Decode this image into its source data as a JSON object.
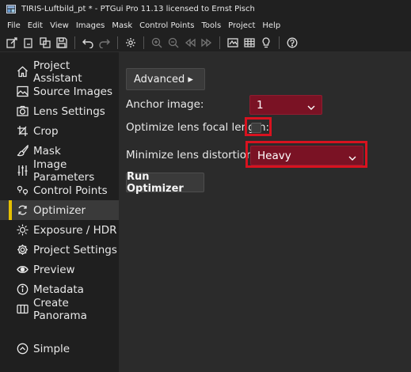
{
  "window": {
    "title": "TIRIS-Luftbild_pt * - PTGui Pro 11.13 licensed to Ernst Pisch"
  },
  "menu": [
    "File",
    "Edit",
    "View",
    "Images",
    "Mask",
    "Control Points",
    "Tools",
    "Project",
    "Help"
  ],
  "toolbar": {
    "icons": [
      "new-project-icon",
      "open-icon",
      "copy-icon",
      "save-icon",
      "undo-icon",
      "redo-icon",
      "settings-icon",
      "zoom-in-icon",
      "zoom-out-icon",
      "previous-icon",
      "next-icon",
      "panorama-editor-icon",
      "table-icon",
      "lightbulb-icon",
      "help-icon"
    ]
  },
  "sidebar": {
    "items": [
      {
        "label": "Project Assistant",
        "icon": "home-icon"
      },
      {
        "label": "Source Images",
        "icon": "image-icon"
      },
      {
        "label": "Lens Settings",
        "icon": "camera-icon"
      },
      {
        "label": "Crop",
        "icon": "crop-icon"
      },
      {
        "label": "Mask",
        "icon": "brush-icon"
      },
      {
        "label": "Image Parameters",
        "icon": "sliders-icon"
      },
      {
        "label": "Control Points",
        "icon": "control-points-icon"
      },
      {
        "label": "Optimizer",
        "icon": "optimizer-icon",
        "active": true
      },
      {
        "label": "Exposure / HDR",
        "icon": "sun-icon"
      },
      {
        "label": "Project Settings",
        "icon": "gear-icon"
      },
      {
        "label": "Preview",
        "icon": "eye-icon"
      },
      {
        "label": "Metadata",
        "icon": "info-icon"
      },
      {
        "label": "Create Panorama",
        "icon": "panorama-icon"
      }
    ],
    "mode": {
      "label": "Simple",
      "icon": "chevron-up-circle-icon"
    }
  },
  "optimizer": {
    "advanced_label": "Advanced ▸",
    "anchor_label": "Anchor image:",
    "anchor_value": "1",
    "focal_label": "Optimize lens focal length:",
    "focal_checked": false,
    "distortion_label": "Minimize lens distortion:",
    "distortion_value": "Heavy",
    "run_label": "Run Optimizer"
  },
  "colors": {
    "accent": "#e6c000",
    "select_bg": "#7a1224",
    "highlight": "#d8121f"
  }
}
